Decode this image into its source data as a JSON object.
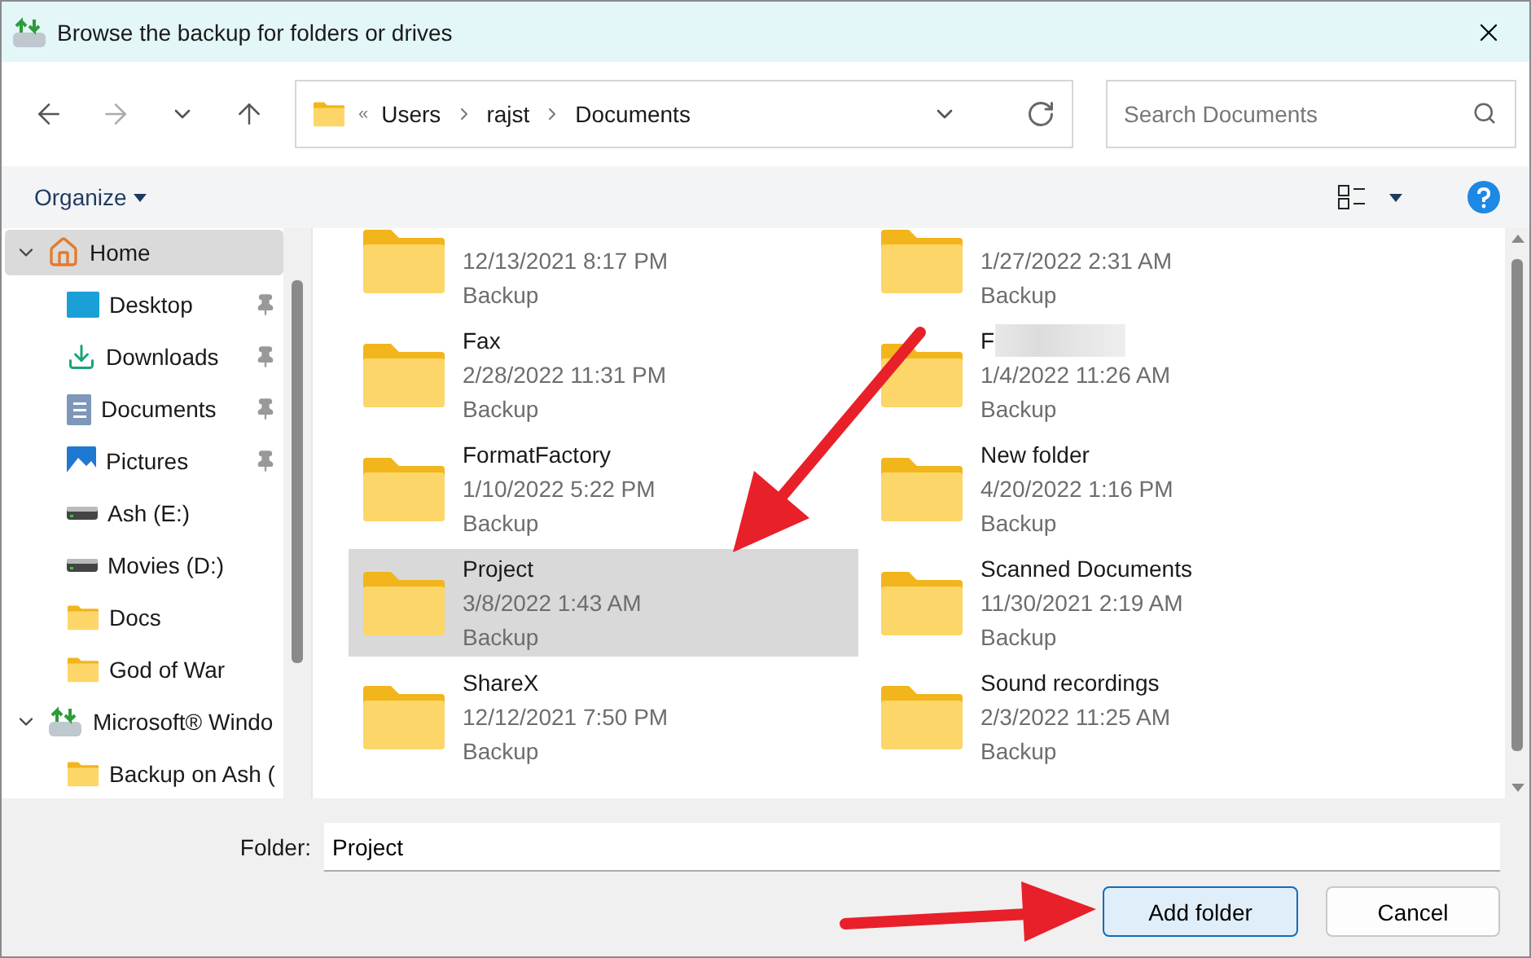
{
  "window": {
    "title": "Browse the backup for folders or drives"
  },
  "address_bar": {
    "overflow": "«",
    "path": [
      "Users",
      "rajst",
      "Documents"
    ]
  },
  "search": {
    "placeholder": "Search Documents"
  },
  "toolbar": {
    "organize": "Organize"
  },
  "sidebar": {
    "items": [
      {
        "label": "Home",
        "kind": "home",
        "selected": true,
        "expanded": true,
        "children": [
          {
            "label": "Desktop",
            "kind": "desktop",
            "selected": false,
            "pinned": true
          },
          {
            "label": "Downloads",
            "kind": "downloads",
            "selected": false,
            "pinned": true
          },
          {
            "label": "Documents",
            "kind": "documents",
            "selected": false,
            "pinned": true
          },
          {
            "label": "Pictures",
            "kind": "pictures",
            "selected": false,
            "pinned": true
          },
          {
            "label": "Ash (E:)",
            "kind": "drive",
            "selected": false,
            "pinned": false
          },
          {
            "label": "Movies (D:)",
            "kind": "drive",
            "selected": false,
            "pinned": false
          },
          {
            "label": "Docs",
            "kind": "folder",
            "selected": false,
            "pinned": false
          },
          {
            "label": "God of War",
            "kind": "folder",
            "selected": false,
            "pinned": false
          }
        ]
      },
      {
        "label": "Microsoft® Windo",
        "kind": "backup",
        "selected": false,
        "expanded": true,
        "children": [
          {
            "label": "Backup on Ash (",
            "kind": "folder",
            "selected": false,
            "pinned": false
          }
        ]
      }
    ]
  },
  "files": [
    {
      "date": "12/13/2021 8:17 PM",
      "type": "Backup",
      "selected": false
    },
    {
      "date": "1/27/2022 2:31 AM",
      "type": "Backup",
      "selected": false
    },
    {
      "name": "Fax",
      "date": "2/28/2022 11:31 PM",
      "type": "Backup",
      "selected": false
    },
    {
      "name": "F",
      "redacted": true,
      "date": "1/4/2022 11:26 AM",
      "type": "Backup",
      "selected": false
    },
    {
      "name": "FormatFactory",
      "date": "1/10/2022 5:22 PM",
      "type": "Backup",
      "selected": false
    },
    {
      "name": "New folder",
      "date": "4/20/2022 1:16 PM",
      "type": "Backup",
      "selected": false
    },
    {
      "name": "Project",
      "date": "3/8/2022 1:43 AM",
      "type": "Backup",
      "selected": true
    },
    {
      "name": "Scanned Documents",
      "date": "11/30/2021 2:19 AM",
      "type": "Backup",
      "selected": false
    },
    {
      "name": "ShareX",
      "date": "12/12/2021 7:50 PM",
      "type": "Backup",
      "selected": false
    },
    {
      "name": "Sound recordings",
      "date": "2/3/2022 11:25 AM",
      "type": "Backup",
      "selected": false
    }
  ],
  "footer": {
    "folder_label": "Folder:",
    "folder_value": "Project",
    "buttons": [
      {
        "label": "Add folder",
        "default": true
      },
      {
        "label": "Cancel",
        "default": false
      }
    ]
  }
}
